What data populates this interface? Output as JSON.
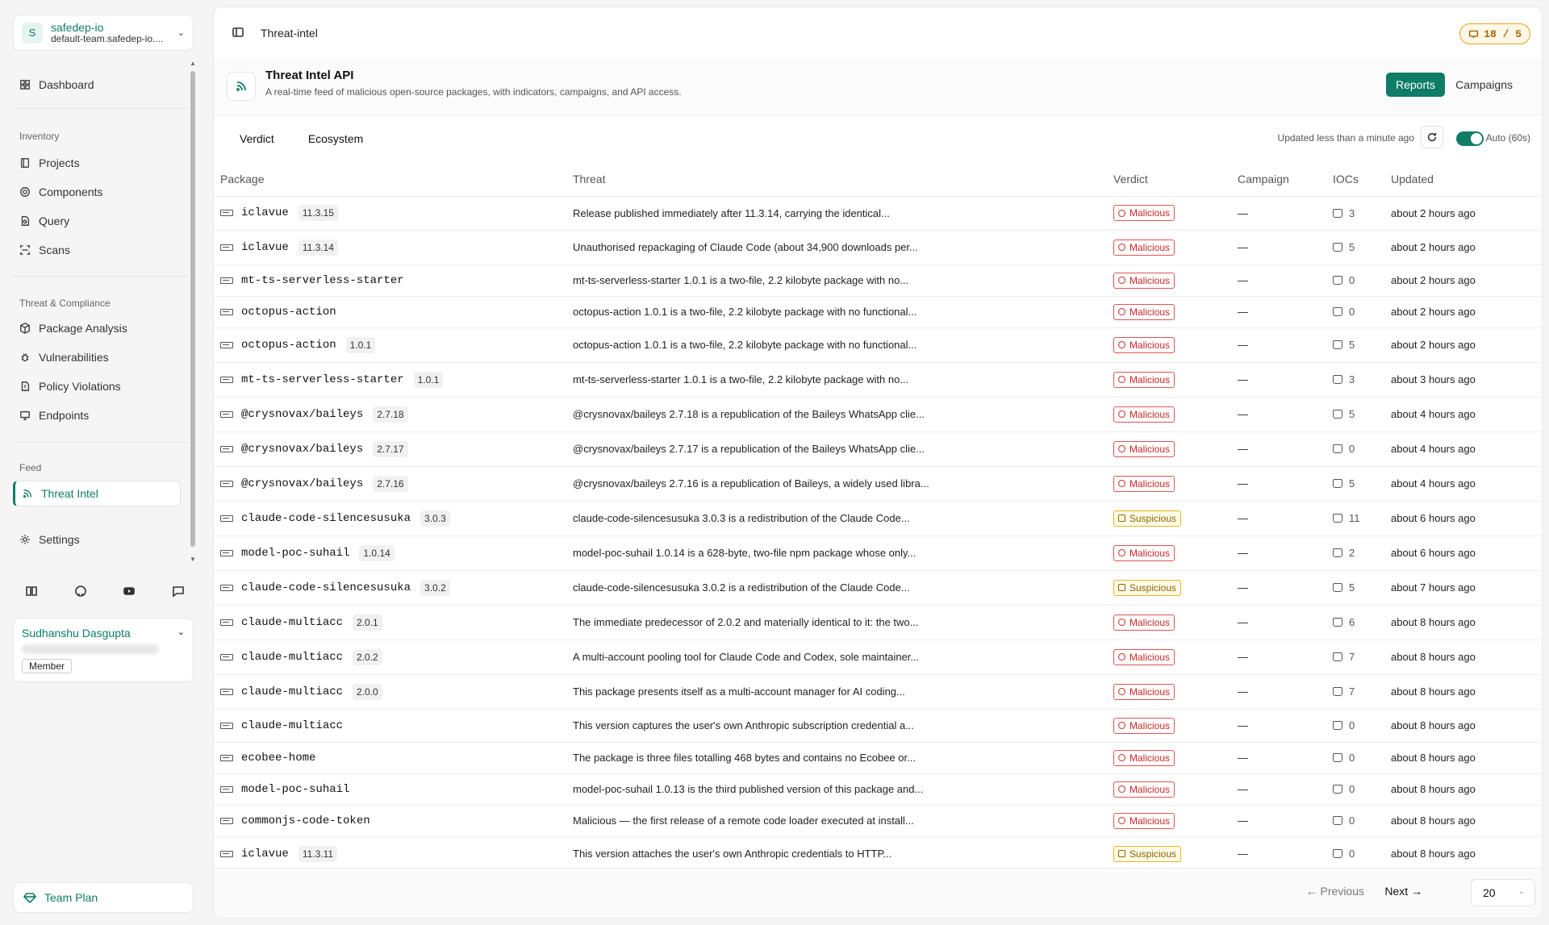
{
  "workspace": {
    "initial": "S",
    "name": "safedep-io",
    "subtitle": "default-team.safedep-io...."
  },
  "nav": {
    "dashboard": "Dashboard",
    "inventory_label": "Inventory",
    "projects": "Projects",
    "components": "Components",
    "query": "Query",
    "scans": "Scans",
    "threat_label": "Threat & Compliance",
    "package_analysis": "Package Analysis",
    "vulnerabilities": "Vulnerabilities",
    "policy_violations": "Policy Violations",
    "endpoints": "Endpoints",
    "feed_label": "Feed",
    "threat_intel": "Threat Intel",
    "settings": "Settings"
  },
  "user": {
    "name": "Sudhanshu Dasgupta",
    "role": "Member"
  },
  "plan": "Team Plan",
  "breadcrumb": "Threat-intel",
  "usage": "18 / 5",
  "header": {
    "title": "Threat Intel API",
    "subtitle": "A real-time feed of malicious open-source packages, with indicators, campaigns, and API access.",
    "reports": "Reports",
    "campaigns": "Campaigns"
  },
  "filters": {
    "verdict": "Verdict",
    "ecosystem": "Ecosystem",
    "status": "Updated less than a minute ago",
    "auto": "Auto (60s)"
  },
  "columns": {
    "package": "Package",
    "threat": "Threat",
    "verdict": "Verdict",
    "campaign": "Campaign",
    "iocs": "IOCs",
    "updated": "Updated"
  },
  "rows": [
    {
      "name": "iclavue",
      "version": "11.3.15",
      "threat": "Release published immediately after 11.3.14, carrying the identical...",
      "verdict": "Malicious",
      "campaign": "—",
      "iocs": "3",
      "updated": "about 2 hours ago"
    },
    {
      "name": "iclavue",
      "version": "11.3.14",
      "threat": "Unauthorised repackaging of Claude Code (about 34,900 downloads per...",
      "verdict": "Malicious",
      "campaign": "—",
      "iocs": "5",
      "updated": "about 2 hours ago"
    },
    {
      "name": "mt-ts-serverless-starter",
      "version": "",
      "threat": "mt-ts-serverless-starter 1.0.1 is a two-file, 2.2 kilobyte package with no...",
      "verdict": "Malicious",
      "campaign": "—",
      "iocs": "0",
      "updated": "about 2 hours ago"
    },
    {
      "name": "octopus-action",
      "version": "",
      "threat": "octopus-action 1.0.1 is a two-file, 2.2 kilobyte package with no functional...",
      "verdict": "Malicious",
      "campaign": "—",
      "iocs": "0",
      "updated": "about 2 hours ago"
    },
    {
      "name": "octopus-action",
      "version": "1.0.1",
      "threat": "octopus-action 1.0.1 is a two-file, 2.2 kilobyte package with no functional...",
      "verdict": "Malicious",
      "campaign": "—",
      "iocs": "5",
      "updated": "about 2 hours ago"
    },
    {
      "name": "mt-ts-serverless-starter",
      "version": "1.0.1",
      "threat": "mt-ts-serverless-starter 1.0.1 is a two-file, 2.2 kilobyte package with no...",
      "verdict": "Malicious",
      "campaign": "—",
      "iocs": "3",
      "updated": "about 3 hours ago"
    },
    {
      "name": "@crysnovax/baileys",
      "version": "2.7.18",
      "threat": "@crysnovax/baileys 2.7.18 is a republication of the Baileys WhatsApp clie...",
      "verdict": "Malicious",
      "campaign": "—",
      "iocs": "5",
      "updated": "about 4 hours ago"
    },
    {
      "name": "@crysnovax/baileys",
      "version": "2.7.17",
      "threat": "@crysnovax/baileys 2.7.17 is a republication of the Baileys WhatsApp clie...",
      "verdict": "Malicious",
      "campaign": "—",
      "iocs": "0",
      "updated": "about 4 hours ago"
    },
    {
      "name": "@crysnovax/baileys",
      "version": "2.7.16",
      "threat": "@crysnovax/baileys 2.7.16 is a republication of Baileys, a widely used libra...",
      "verdict": "Malicious",
      "campaign": "—",
      "iocs": "5",
      "updated": "about 4 hours ago"
    },
    {
      "name": "claude-code-silencesusuka",
      "version": "3.0.3",
      "threat": "claude-code-silencesusuka 3.0.3 is a redistribution of the Claude Code...",
      "verdict": "Suspicious",
      "campaign": "—",
      "iocs": "11",
      "updated": "about 6 hours ago"
    },
    {
      "name": "model-poc-suhail",
      "version": "1.0.14",
      "threat": "model-poc-suhail 1.0.14 is a 628-byte, two-file npm package whose only...",
      "verdict": "Malicious",
      "campaign": "—",
      "iocs": "2",
      "updated": "about 6 hours ago"
    },
    {
      "name": "claude-code-silencesusuka",
      "version": "3.0.2",
      "threat": "claude-code-silencesusuka 3.0.2 is a redistribution of the Claude Code...",
      "verdict": "Suspicious",
      "campaign": "—",
      "iocs": "5",
      "updated": "about 7 hours ago"
    },
    {
      "name": "claude-multiacc",
      "version": "2.0.1",
      "threat": "The immediate predecessor of 2.0.2 and materially identical to it: the two...",
      "verdict": "Malicious",
      "campaign": "—",
      "iocs": "6",
      "updated": "about 8 hours ago"
    },
    {
      "name": "claude-multiacc",
      "version": "2.0.2",
      "threat": "A multi-account pooling tool for Claude Code and Codex, sole maintainer...",
      "verdict": "Malicious",
      "campaign": "—",
      "iocs": "7",
      "updated": "about 8 hours ago"
    },
    {
      "name": "claude-multiacc",
      "version": "2.0.0",
      "threat": "This package presents itself as a multi-account manager for AI coding...",
      "verdict": "Malicious",
      "campaign": "—",
      "iocs": "7",
      "updated": "about 8 hours ago"
    },
    {
      "name": "claude-multiacc",
      "version": "",
      "threat": "This version captures the user's own Anthropic subscription credential a...",
      "verdict": "Malicious",
      "campaign": "—",
      "iocs": "0",
      "updated": "about 8 hours ago"
    },
    {
      "name": "ecobee-home",
      "version": "",
      "threat": "The package is three files totalling 468 bytes and contains no Ecobee or...",
      "verdict": "Malicious",
      "campaign": "—",
      "iocs": "0",
      "updated": "about 8 hours ago"
    },
    {
      "name": "model-poc-suhail",
      "version": "",
      "threat": "model-poc-suhail 1.0.13 is the third published version of this package and...",
      "verdict": "Malicious",
      "campaign": "—",
      "iocs": "0",
      "updated": "about 8 hours ago"
    },
    {
      "name": "commonjs-code-token",
      "version": "",
      "threat": "Malicious — the first release of a remote code loader executed at install...",
      "verdict": "Malicious",
      "campaign": "—",
      "iocs": "0",
      "updated": "about 8 hours ago"
    },
    {
      "name": "iclavue",
      "version": "11.3.11",
      "threat": "This version attaches the user's own Anthropic credentials to HTTP...",
      "verdict": "Suspicious",
      "campaign": "—",
      "iocs": "0",
      "updated": "about 8 hours ago"
    }
  ],
  "pagination": {
    "previous": "Previous",
    "next": "Next",
    "page_size": "20"
  },
  "colors": {
    "accent": "#0e7c66",
    "malicious": "#c62828",
    "suspicious": "#8a6500"
  }
}
